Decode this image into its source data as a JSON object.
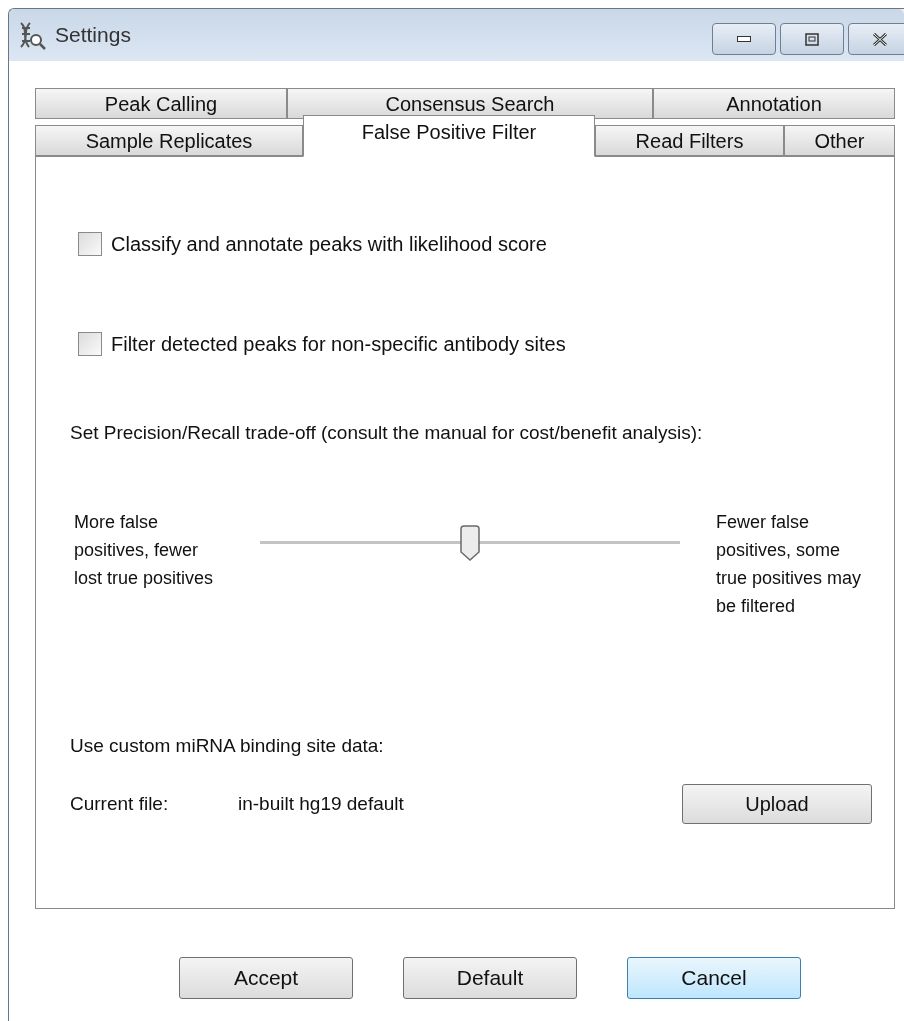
{
  "window": {
    "title": "Settings"
  },
  "tab_rows": [
    [
      {
        "label": "Peak Calling",
        "selected": false
      },
      {
        "label": "Consensus Search",
        "selected": false
      },
      {
        "label": "Annotation",
        "selected": false
      }
    ],
    [
      {
        "label": "Sample Replicates",
        "selected": false
      },
      {
        "label": "False Positive Filter",
        "selected": true
      },
      {
        "label": "Read Filters",
        "selected": false
      },
      {
        "label": "Other",
        "selected": false
      }
    ]
  ],
  "checkboxes": [
    {
      "label": "Classify and annotate peaks with likelihood score",
      "checked": false
    },
    {
      "label": "Filter detected peaks for non-specific antibody sites",
      "checked": false
    }
  ],
  "tradeoff": {
    "prompt": "Set Precision/Recall trade-off (consult the manual for cost/benefit analysis):",
    "left_label": "More false positives, fewer lost true positives",
    "right_label": "Fewer false positives, some true positives may be filtered",
    "level": 0.5
  },
  "mirna": {
    "prompt": "Use custom miRNA binding site data:",
    "file_label": "Current file:",
    "file_value": "in-built hg19 default",
    "upload_button": "Upload"
  },
  "buttons": [
    {
      "label": "Accept",
      "focused": false
    },
    {
      "label": "Default",
      "focused": false
    },
    {
      "label": "Cancel",
      "focused": true
    }
  ]
}
